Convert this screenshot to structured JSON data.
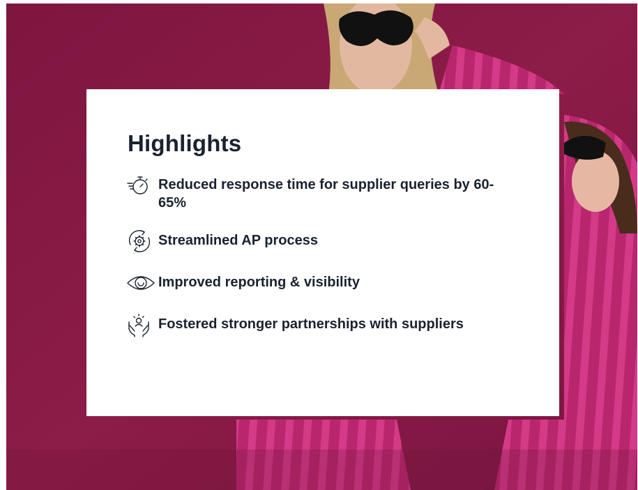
{
  "panel": {
    "title": "Highlights",
    "items": [
      {
        "icon": "stopwatch-icon",
        "label": "Reduced response time for supplier queries by 60-65%"
      },
      {
        "icon": "gear-cycle-icon",
        "label": "Streamlined AP process"
      },
      {
        "icon": "eye-icon",
        "label": "Improved reporting & visibility"
      },
      {
        "icon": "hands-partnership-icon",
        "label": "Fostered stronger partnerships with suppliers"
      }
    ]
  },
  "colors": {
    "background": "#8a1a45",
    "card": "#ffffff",
    "text": "#1a2230"
  }
}
